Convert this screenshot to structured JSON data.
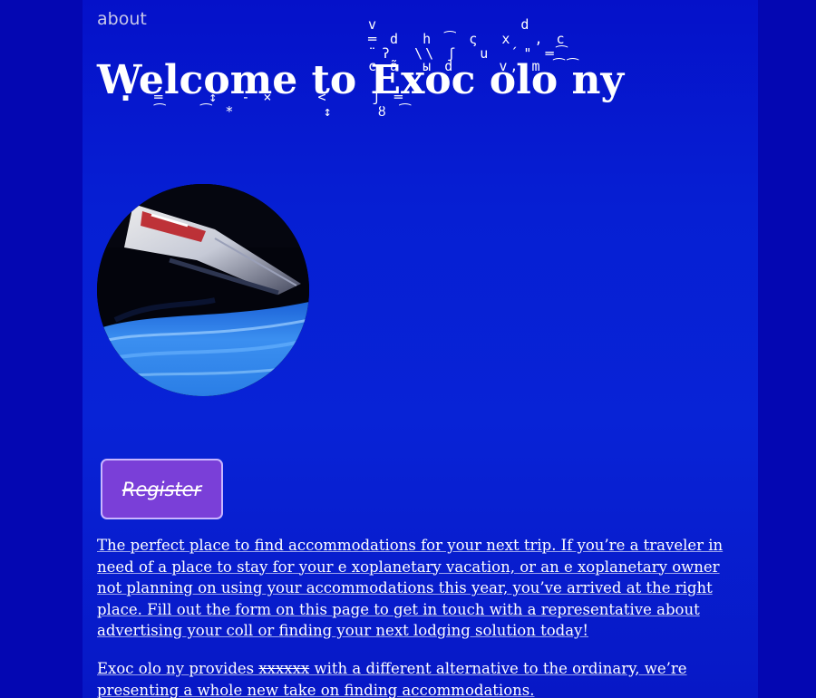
{
  "nav": {
    "about_label": "about"
  },
  "header": {
    "title": "Welcome to Exoc olo ny"
  },
  "hero": {
    "image": "spaceship-over-water-image"
  },
  "actions": {
    "register_label": "Register"
  },
  "content": {
    "paragraph_1": "The perfect place to find accommodations for your next trip. If you’re a traveler in need of a place to stay for your e xoplanetary vacation, or an e xoplanetary owner not planning on using your accommodations this year, you’ve arrived at the right place. Fill out the form on this page to get in touch with a representative about advertising your coll or finding your next lodging solution today!",
    "paragraph_2_start": "Exoc olo ny provides ",
    "paragraph_2_strike": "xxxxxx",
    "paragraph_2_end": " with a different alternative to the ordinary, we’re presenting a whole new take on finding accommodations."
  },
  "colors": {
    "background": "#0407b2",
    "panel": "#0823d6",
    "button": "#7a3fd8",
    "button_border": "#c9b6ff",
    "nav_link": "#c8c8e8"
  }
}
